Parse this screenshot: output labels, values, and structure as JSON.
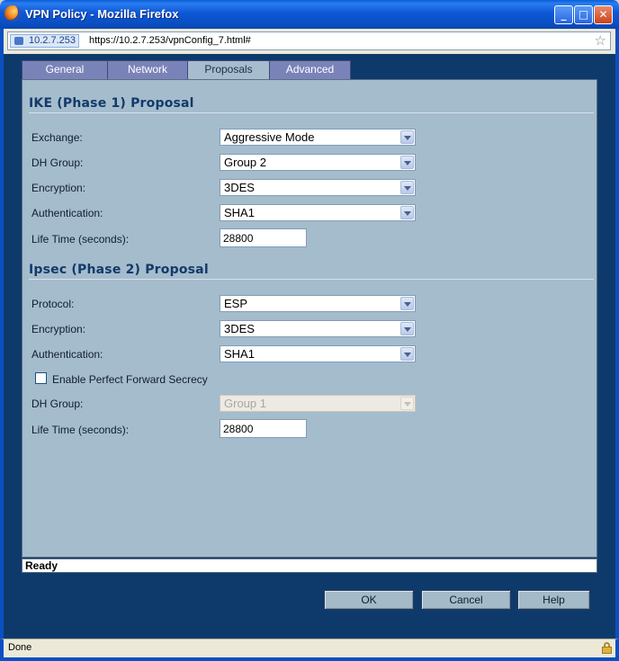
{
  "window": {
    "title": "VPN Policy - Mozilla Firefox"
  },
  "urlbar": {
    "site": "10.2.7.253",
    "url": "https://10.2.7.253/vpnConfig_7.html#"
  },
  "tabs": [
    {
      "label": "General",
      "active": false
    },
    {
      "label": "Network",
      "active": false
    },
    {
      "label": "Proposals",
      "active": true
    },
    {
      "label": "Advanced",
      "active": false
    }
  ],
  "ike": {
    "title": "IKE (Phase 1) Proposal",
    "exchange_label": "Exchange:",
    "exchange_value": "Aggressive Mode",
    "dh_label": "DH Group:",
    "dh_value": "Group 2",
    "encryption_label": "Encryption:",
    "encryption_value": "3DES",
    "auth_label": "Authentication:",
    "auth_value": "SHA1",
    "lifetime_label": "Life Time (seconds):",
    "lifetime_value": "28800"
  },
  "ipsec": {
    "title": "Ipsec (Phase 2) Proposal",
    "protocol_label": "Protocol:",
    "protocol_value": "ESP",
    "encryption_label": "Encryption:",
    "encryption_value": "3DES",
    "auth_label": "Authentication:",
    "auth_value": "SHA1",
    "pfs_label": "Enable Perfect Forward Secrecy",
    "pfs_checked": false,
    "dh_label": "DH Group:",
    "dh_value": "Group 1",
    "lifetime_label": "Life Time (seconds):",
    "lifetime_value": "28800"
  },
  "status": {
    "text": "Ready"
  },
  "buttons": {
    "ok": "OK",
    "cancel": "Cancel",
    "help": "Help"
  },
  "browser_status": {
    "text": "Done"
  },
  "colors": {
    "panel_bg": "#a5bccd",
    "frame_bg": "#0e3a6b",
    "section_title": "#123a6a",
    "tab_inactive": "#7a83b8"
  }
}
